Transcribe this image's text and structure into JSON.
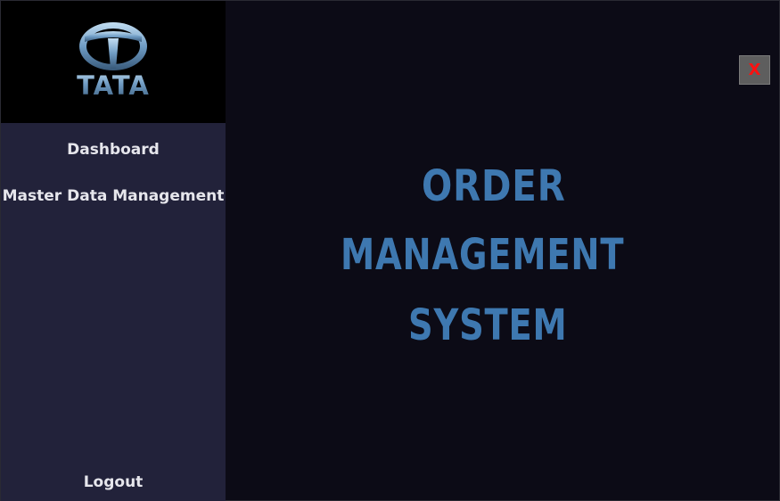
{
  "sidebar": {
    "logo": {
      "brand_text": "TATA",
      "emblem_icon": "tata-t-emblem-icon"
    },
    "items": [
      {
        "label": "Dashboard"
      },
      {
        "label": "Master Data Management"
      }
    ],
    "logout_label": "Logout"
  },
  "main": {
    "close_label": "X",
    "title_lines": [
      "ORDER",
      "MANAGEMENT",
      "SYSTEM"
    ]
  },
  "colors": {
    "sidebar_bg": "#22223a",
    "main_bg": "#0c0b16",
    "title_blue": "#3e78b0",
    "close_red": "#ff1010"
  }
}
